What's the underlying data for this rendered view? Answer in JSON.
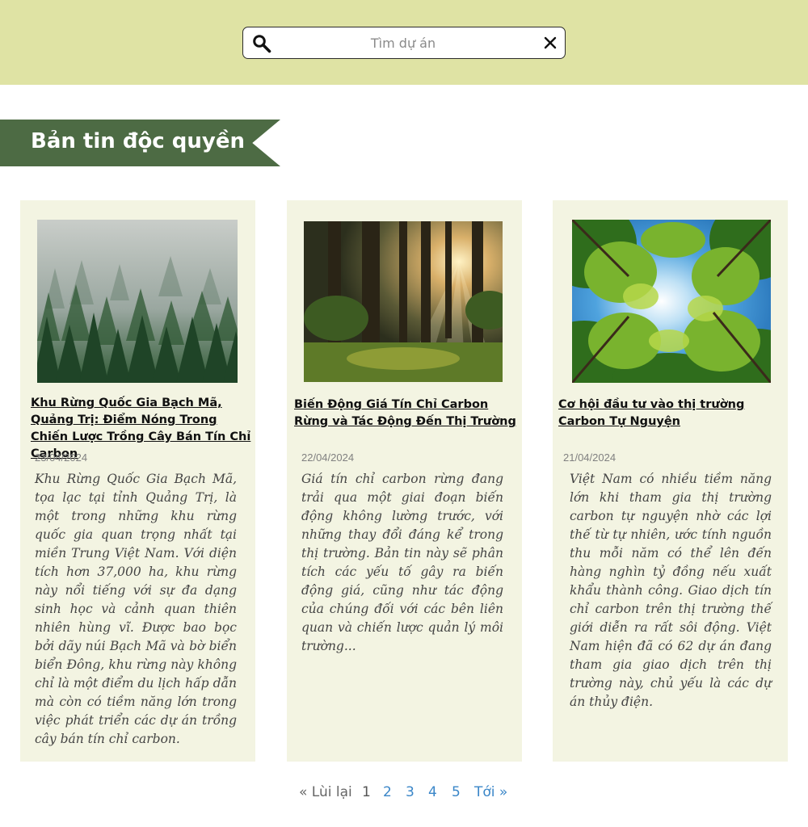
{
  "search": {
    "placeholder": "Tìm dự án"
  },
  "section": {
    "title": "Bản tin độc quyền"
  },
  "articles": [
    {
      "title": "Khu Rừng Quốc Gia Bạch Mã, Quảng Trị: Điểm Nóng Trong Chiến Lược Trồng Cây Bán Tín Chỉ Carbon",
      "date": "23/04/2024",
      "excerpt": "Khu Rừng Quốc Gia Bạch Mã, tọa lạc tại tỉnh Quảng Trị, là một trong những khu rừng quốc gia quan trọng nhất tại miền Trung Việt Nam. Với diện tích hơn 37,000 ha, khu rừng này nổi tiếng với sự đa dạng sinh học và cảnh quan thiên nhiên hùng vĩ. Được bao bọc bởi dãy núi Bạch Mã và bờ biển biển Đông, khu rừng này không chỉ là một điểm du lịch hấp dẫn mà còn có tiềm năng lớn trong việc phát triển các dự án trồng cây bán tín chỉ carbon."
    },
    {
      "title": "Biến Động Giá Tín Chỉ Carbon Rừng và Tác Động Đến Thị Trường",
      "date": "22/04/2024",
      "excerpt": "Giá tín chỉ carbon rừng đang trải qua một giai đoạn biến động không lường trước, với những thay đổi đáng kể trong thị trường. Bản tin này sẽ phân tích các yếu tố gây ra biến động giá, cũng như tác động của chúng đối với các bên liên quan và chiến lược quản lý môi trường..."
    },
    {
      "title": "Cơ hội đầu tư vào thị  trường Carbon Tự Nguyện",
      "date": "21/04/2024",
      "excerpt": "Việt Nam có nhiều tiềm năng lớn khi tham gia thị trường carbon tự nguyện nhờ các lợi thế từ tự nhiên, ước tính nguồn thu mỗi năm có thể lên đến hàng nghìn tỷ đồng nếu xuất khẩu thành công. Giao dịch tín chỉ carbon trên thị trường thế giới diễn ra rất sôi động. Việt Nam hiện đã có 62 dự án đang tham gia giao dịch trên thị trường này, chủ yếu là các dự án thủy điện."
    }
  ],
  "pagination": {
    "prev": "« Lùi lại",
    "pages": [
      "1",
      "2",
      "3",
      "4",
      "5"
    ],
    "current": "1",
    "next": "Tới »"
  },
  "colors": {
    "header_bg": "#dfe3a4",
    "banner_bg": "#4d6b44",
    "card_bg": "#f3f4e2",
    "link": "#3a86c8"
  }
}
